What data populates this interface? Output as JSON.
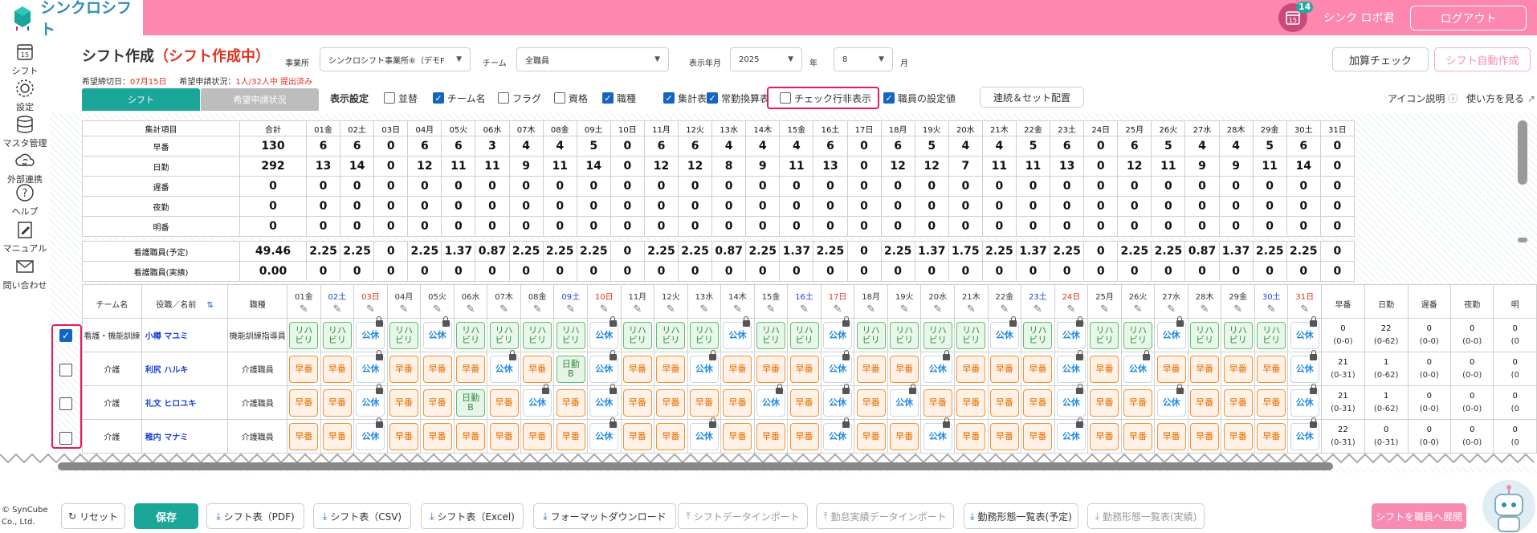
{
  "app": {
    "name": "シンクロシフト",
    "user": "シンク ロボ君",
    "logout": "ログアウト",
    "badge": "14",
    "calendar_day": "15"
  },
  "sidebar": [
    {
      "label": "シフト",
      "icon": "calendar-icon"
    },
    {
      "label": "設定",
      "icon": "gear-icon"
    },
    {
      "label": "マスタ管理",
      "icon": "database-icon"
    },
    {
      "label": "外部連携",
      "icon": "cloud-sync-icon"
    },
    {
      "label": "ヘルプ",
      "icon": "help-icon"
    },
    {
      "label": "マニュアル",
      "icon": "manual-icon"
    },
    {
      "label": "問い合わせ",
      "icon": "mail-icon"
    }
  ],
  "page": {
    "title": "シフト作成",
    "mode": "（シフト作成中）",
    "office_label": "事業所",
    "office_value": "シンクロシフト事業所⑥（デモF",
    "team_label": "チーム",
    "team_value": "全職員",
    "ym_label": "表示年月",
    "year_value": "2025",
    "year_unit": "年",
    "month_value": "8",
    "month_unit": "月",
    "deadline_label": "希望締切日：",
    "deadline_value": "07月15日",
    "request_label": "希望申請状況：",
    "request_value": "1人/32人中 提出済み",
    "add_check": "加算チェック",
    "auto_create": "シフト自動作成"
  },
  "tabs": {
    "shift": "シフト",
    "request": "希望申請状況"
  },
  "display": {
    "label": "表示設定",
    "options": [
      {
        "label": "並替",
        "checked": false
      },
      {
        "label": "チーム名",
        "checked": true
      },
      {
        "label": "フラグ",
        "checked": false
      },
      {
        "label": "資格",
        "checked": false
      },
      {
        "label": "職種",
        "checked": true
      },
      {
        "label": "集計表",
        "checked": true
      },
      {
        "label": "常勤換算表",
        "checked": true
      },
      {
        "label": "チェック行非表示",
        "checked": false
      },
      {
        "label": "職員の設定値",
        "checked": true
      }
    ],
    "continuous": "連続＆セット配置",
    "icon_help": "アイコン説明",
    "howto": "使い方を見る"
  },
  "days": [
    "01金",
    "02土",
    "03日",
    "04月",
    "05火",
    "06水",
    "07木",
    "08金",
    "09土",
    "10日",
    "11月",
    "12火",
    "13水",
    "14木",
    "15金",
    "16土",
    "17日",
    "18月",
    "19火",
    "20水",
    "21木",
    "22金",
    "23土",
    "24日",
    "25月",
    "26火",
    "27水",
    "28木",
    "29金",
    "30土",
    "31日"
  ],
  "summary": {
    "header": "集計項目",
    "total_header": "合計",
    "rows": [
      {
        "label": "早番",
        "total": "130",
        "values": [
          "6",
          "6",
          "0",
          "6",
          "6",
          "3",
          "4",
          "4",
          "5",
          "0",
          "6",
          "6",
          "4",
          "4",
          "4",
          "6",
          "0",
          "6",
          "5",
          "4",
          "4",
          "5",
          "6",
          "0",
          "6",
          "5",
          "4",
          "4",
          "5",
          "6",
          "0"
        ]
      },
      {
        "label": "日勤",
        "total": "292",
        "values": [
          "13",
          "14",
          "0",
          "12",
          "11",
          "11",
          "9",
          "11",
          "14",
          "0",
          "12",
          "12",
          "8",
          "9",
          "11",
          "13",
          "0",
          "12",
          "12",
          "7",
          "11",
          "11",
          "13",
          "0",
          "12",
          "11",
          "9",
          "9",
          "11",
          "14",
          "0"
        ]
      },
      {
        "label": "遅番",
        "total": "0",
        "values": [
          "0",
          "0",
          "0",
          "0",
          "0",
          "0",
          "0",
          "0",
          "0",
          "0",
          "0",
          "0",
          "0",
          "0",
          "0",
          "0",
          "0",
          "0",
          "0",
          "0",
          "0",
          "0",
          "0",
          "0",
          "0",
          "0",
          "0",
          "0",
          "0",
          "0",
          "0"
        ]
      },
      {
        "label": "夜勤",
        "total": "0",
        "values": [
          "0",
          "0",
          "0",
          "0",
          "0",
          "0",
          "0",
          "0",
          "0",
          "0",
          "0",
          "0",
          "0",
          "0",
          "0",
          "0",
          "0",
          "0",
          "0",
          "0",
          "0",
          "0",
          "0",
          "0",
          "0",
          "0",
          "0",
          "0",
          "0",
          "0",
          "0"
        ]
      },
      {
        "label": "明番",
        "total": "0",
        "values": [
          "0",
          "0",
          "0",
          "0",
          "0",
          "0",
          "0",
          "0",
          "0",
          "0",
          "0",
          "0",
          "0",
          "0",
          "0",
          "0",
          "0",
          "0",
          "0",
          "0",
          "0",
          "0",
          "0",
          "0",
          "0",
          "0",
          "0",
          "0",
          "0",
          "0",
          "0"
        ]
      }
    ],
    "nurse_rows": [
      {
        "label": "看護職員(予定)",
        "total": "49.46",
        "values": [
          "2.25",
          "2.25",
          "0",
          "2.25",
          "1.37",
          "0.87",
          "2.25",
          "2.25",
          "2.25",
          "0",
          "2.25",
          "2.25",
          "0.87",
          "2.25",
          "1.37",
          "2.25",
          "0",
          "2.25",
          "1.37",
          "1.75",
          "2.25",
          "1.37",
          "2.25",
          "0",
          "2.25",
          "2.25",
          "0.87",
          "1.37",
          "2.25",
          "2.25",
          "0"
        ]
      },
      {
        "label": "看護職員(実績)",
        "total": "0.00",
        "values": [
          "0",
          "0",
          "0",
          "0",
          "0",
          "0",
          "0",
          "0",
          "0",
          "0",
          "0",
          "0",
          "0",
          "0",
          "0",
          "0",
          "0",
          "0",
          "0",
          "0",
          "0",
          "0",
          "0",
          "0",
          "0",
          "0",
          "0",
          "0",
          "0",
          "0",
          "0"
        ]
      }
    ]
  },
  "staff_header": {
    "team": "チーム名",
    "name": "役職／名前",
    "job": "職種",
    "stats": [
      "早番",
      "日勤",
      "遅番",
      "夜勤",
      "明"
    ]
  },
  "staff": [
    {
      "team": "看護・機能訓練",
      "name": "小樽 マユミ",
      "job": "機能訓練指導員",
      "checked": true,
      "shifts": [
        "リハビリ",
        "リハビリ",
        "公休",
        "リハビリ",
        "公休",
        "リハビリ",
        "リハビリ",
        "リハビリ",
        "リハビリ",
        "公休",
        "リハビリ",
        "リハビリ",
        "リハビリ",
        "公休",
        "リハビリ",
        "リハビリ",
        "公休",
        "リハビリ",
        "リハビリ",
        "リハビリ",
        "リハビリ",
        "公休",
        "リハビリ",
        "公休",
        "リハビリ",
        "リハビリ",
        "公休",
        "リハビリ",
        "リハビリ",
        "リハビリ",
        "公休"
      ],
      "stats": [
        [
          "0",
          "(0-0)"
        ],
        [
          "22",
          "(0-62)"
        ],
        [
          "0",
          "(0-0)"
        ],
        [
          "0",
          "(0-0)"
        ],
        [
          "0",
          "(0"
        ]
      ]
    },
    {
      "team": "介護",
      "name": "利尻 ハルキ",
      "job": "介護職員",
      "checked": false,
      "shifts": [
        "早番",
        "早番",
        "公休",
        "早番",
        "早番",
        "早番",
        "公休",
        "早番",
        "日勤B",
        "公休",
        "早番",
        "早番",
        "公休",
        "早番",
        "早番",
        "早番",
        "公休",
        "早番",
        "早番",
        "公休",
        "早番",
        "早番",
        "早番",
        "公休",
        "早番",
        "公休",
        "早番",
        "早番",
        "早番",
        "早番",
        "公休"
      ],
      "stats": [
        [
          "21",
          "(0-31)"
        ],
        [
          "1",
          "(0-62)"
        ],
        [
          "0",
          "(0-0)"
        ],
        [
          "0",
          "(0-0)"
        ],
        [
          "0",
          "(0"
        ]
      ]
    },
    {
      "team": "介護",
      "name": "礼文 ヒロユキ",
      "job": "介護職員",
      "checked": false,
      "shifts": [
        "早番",
        "早番",
        "公休",
        "早番",
        "早番",
        "日勤B",
        "早番",
        "公休",
        "早番",
        "公休",
        "早番",
        "早番",
        "早番",
        "早番",
        "公休",
        "早番",
        "公休",
        "早番",
        "公休",
        "早番",
        "早番",
        "早番",
        "早番",
        "公休",
        "早番",
        "早番",
        "公休",
        "早番",
        "早番",
        "早番",
        "公休"
      ],
      "stats": [
        [
          "21",
          "(0-31)"
        ],
        [
          "1",
          "(0-62)"
        ],
        [
          "0",
          "(0-0)"
        ],
        [
          "0",
          "(0-0)"
        ],
        [
          "0",
          "(0"
        ]
      ]
    },
    {
      "team": "介護",
      "name": "稚内 マナミ",
      "job": "介護職員",
      "checked": false,
      "shifts": [
        "早番",
        "早番",
        "公休",
        "早番",
        "早番",
        "早番",
        "早番",
        "早番",
        "早番",
        "公休",
        "早番",
        "早番",
        "公休",
        "早番",
        "早番",
        "早番",
        "公休",
        "早番",
        "早番",
        "公休",
        "早番",
        "早番",
        "早番",
        "公休",
        "早番",
        "早番",
        "早番",
        "早番",
        "早番",
        "早番",
        "公休"
      ],
      "stats": [
        [
          "22",
          "(0-31)"
        ],
        [
          "0",
          "(0-31)"
        ],
        [
          "0",
          "(0-0)"
        ],
        [
          "0",
          "(0-0)"
        ],
        [
          "0",
          "(0"
        ]
      ]
    }
  ],
  "footer": {
    "copyright": "© SynCube Co., Ltd.",
    "reset": "リセット",
    "save": "保存",
    "pdf": "シフト表（PDF)",
    "csv": "シフト表（CSV)",
    "excel": "シフト表（Excel)",
    "format": "フォーマットダウンロード",
    "import": "シフトデータインポート",
    "attendance": "勤怠実績データインポート",
    "planned": "勤務形態一覧表(予定)",
    "actual": "勤務形態一覧表(実績)",
    "deploy": "シフトを職員へ展開"
  },
  "colors": {
    "header": "#fe87af",
    "accent": "#1aa79a",
    "highlight": "#e5195f",
    "blue": "#1a3fdb",
    "red": "#e0301e"
  }
}
